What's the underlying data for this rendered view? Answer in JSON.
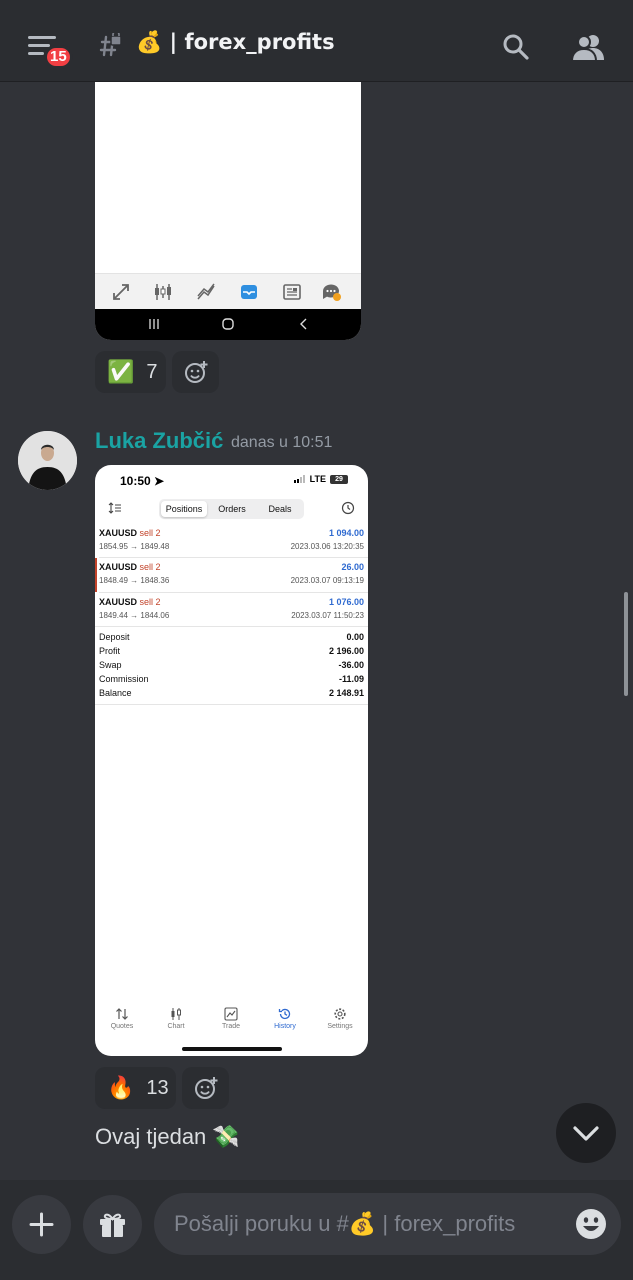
{
  "header": {
    "notification_count": "15",
    "channel_emoji": "💰",
    "channel_name": "| forex_profits",
    "icons": [
      "hamburger-icon",
      "hash-lock-icon",
      "search-icon",
      "members-icon"
    ]
  },
  "message1": {
    "reactions": [
      {
        "emoji": "✅",
        "count": "7"
      }
    ]
  },
  "message2": {
    "username": "Luka Zubčić",
    "username_color": "#1aa3a3",
    "timestamp": "danas u 10:51",
    "screenshot": {
      "status_time": "10:50",
      "network": "LTE",
      "battery": "29",
      "segments": [
        "Positions",
        "Orders",
        "Deals"
      ],
      "active_segment": "Positions",
      "positions": [
        {
          "symbol": "XAUUSD",
          "side": "sell 2",
          "prices": "1854.95 → 1849.48",
          "profit": "1 094.00",
          "date": "2023.03.06 13:20:35"
        },
        {
          "symbol": "XAUUSD",
          "side": "sell 2",
          "prices": "1848.49 → 1848.36",
          "profit": "26.00",
          "date": "2023.03.07 09:13:19"
        },
        {
          "symbol": "XAUUSD",
          "side": "sell 2",
          "prices": "1849.44 → 1844.06",
          "profit": "1 076.00",
          "date": "2023.03.07 11:50:23"
        }
      ],
      "summary": [
        {
          "label": "Deposit",
          "value": "0.00"
        },
        {
          "label": "Profit",
          "value": "2 196.00"
        },
        {
          "label": "Swap",
          "value": "-36.00"
        },
        {
          "label": "Commission",
          "value": "-11.09"
        },
        {
          "label": "Balance",
          "value": "2 148.91"
        }
      ],
      "tabs": [
        "Quotes",
        "Chart",
        "Trade",
        "History",
        "Settings"
      ],
      "active_tab": "History"
    },
    "reactions": [
      {
        "emoji": "🔥",
        "count": "13"
      }
    ],
    "text": "Ovaj tjedan 💸"
  },
  "composer": {
    "placeholder": "Pošalji poruku u #💰 | forex_profits"
  },
  "colors": {
    "background": "#313338",
    "header": "#2b2d31",
    "badge": "#f23f43",
    "profit_blue": "#2f6ad0",
    "sell_red": "#c2432a"
  }
}
